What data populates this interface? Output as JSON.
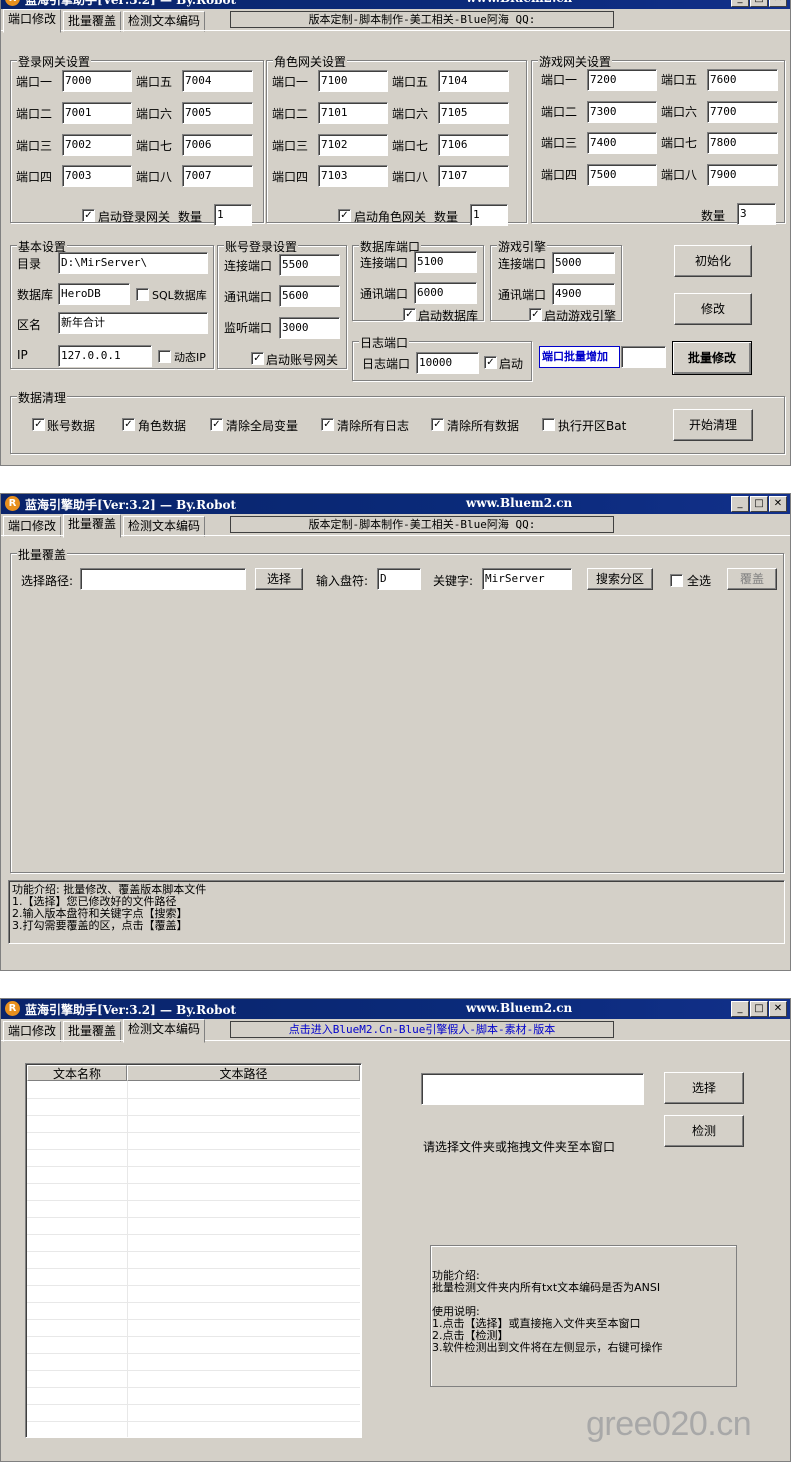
{
  "app": {
    "icon_glyph": "R",
    "title": "蓝海引擎助手[Ver:3.2] — By.Robot",
    "site": "www.Bluem2.cn",
    "tabs": [
      "端口修改",
      "批量覆盖",
      "检测文本编码"
    ]
  },
  "window1": {
    "banner": "版本定制-脚本制作-美工相关-Blue阿海 QQ:",
    "login_gateway": {
      "title": "登录网关设置",
      "ports": [
        {
          "label": "端口一",
          "value": "7000"
        },
        {
          "label": "端口五",
          "value": "7004"
        },
        {
          "label": "端口二",
          "value": "7001"
        },
        {
          "label": "端口六",
          "value": "7005"
        },
        {
          "label": "端口三",
          "value": "7002"
        },
        {
          "label": "端口七",
          "value": "7006"
        },
        {
          "label": "端口四",
          "value": "7003"
        },
        {
          "label": "端口八",
          "value": "7007"
        }
      ],
      "start_label": "启动登录网关",
      "count_label": "数量",
      "count_value": "1"
    },
    "role_gateway": {
      "title": "角色网关设置",
      "ports": [
        {
          "label": "端口一",
          "value": "7100"
        },
        {
          "label": "端口五",
          "value": "7104"
        },
        {
          "label": "端口二",
          "value": "7101"
        },
        {
          "label": "端口六",
          "value": "7105"
        },
        {
          "label": "端口三",
          "value": "7102"
        },
        {
          "label": "端口七",
          "value": "7106"
        },
        {
          "label": "端口四",
          "value": "7103"
        },
        {
          "label": "端口八",
          "value": "7107"
        }
      ],
      "start_label": "启动角色网关",
      "count_label": "数量",
      "count_value": "1"
    },
    "game_gateway": {
      "title": "游戏网关设置",
      "ports": [
        {
          "label": "端口一",
          "value": "7200"
        },
        {
          "label": "端口五",
          "value": "7600"
        },
        {
          "label": "端口二",
          "value": "7300"
        },
        {
          "label": "端口六",
          "value": "7700"
        },
        {
          "label": "端口三",
          "value": "7400"
        },
        {
          "label": "端口七",
          "value": "7800"
        },
        {
          "label": "端口四",
          "value": "7500"
        },
        {
          "label": "端口八",
          "value": "7900"
        }
      ],
      "count_label": "数量",
      "count_value": "3"
    },
    "basic": {
      "title": "基本设置",
      "dir_label": "目录",
      "dir_value": "D:\\MirServer\\",
      "db_label": "数据库",
      "db_value": "HeroDB",
      "sql_label": "SQL数据库",
      "zone_label": "区名",
      "zone_value": "新年合计",
      "ip_label": "IP",
      "ip_value": "127.0.0.1",
      "dynamic_ip_label": "动态IP"
    },
    "account_login": {
      "title": "账号登录设置",
      "connect_label": "连接端口",
      "connect_value": "5500",
      "comm_label": "通讯端口",
      "comm_value": "5600",
      "listen_label": "监听端口",
      "listen_value": "3000",
      "start_label": "启动账号网关"
    },
    "database_port": {
      "title": "数据库端口",
      "connect_label": "连接端口",
      "connect_value": "5100",
      "comm_label": "通讯端口",
      "comm_value": "6000",
      "start_label": "启动数据库"
    },
    "game_engine": {
      "title": "游戏引擎",
      "connect_label": "连接端口",
      "connect_value": "5000",
      "comm_label": "通讯端口",
      "comm_value": "4900",
      "start_label": "启动游戏引擎"
    },
    "log_port": {
      "title": "日志端口",
      "port_label": "日志端口",
      "port_value": "10000",
      "start_label": "启动"
    },
    "buttons": {
      "init": "初始化",
      "modify": "修改",
      "batch_add": "端口批量增加",
      "batch_modify": "批量修改"
    },
    "cleanup": {
      "title": "数据清理",
      "items": [
        "账号数据",
        "角色数据",
        "清除全局变量",
        "清除所有日志",
        "清除所有数据",
        "执行开区Bat"
      ],
      "start": "开始清理"
    }
  },
  "window2": {
    "banner": "版本定制-脚本制作-美工相关-Blue阿海 QQ:",
    "group_title": "批量覆盖",
    "path_label": "选择路径:",
    "path_value": "",
    "select_btn": "选择",
    "drive_label": "输入盘符:",
    "drive_value": "D",
    "keyword_label": "关键字:",
    "keyword_value": "MirServer",
    "search_btn": "搜索分区",
    "select_all_label": "全选",
    "overwrite_btn": "覆盖",
    "info": "功能介绍: 批量修改、覆盖版本脚本文件\n1.【选择】您已修改好的文件路径\n2.输入版本盘符和关键字点【搜索】\n3.打勾需要覆盖的区，点击【覆盖】"
  },
  "window3": {
    "banner": "点击进入BlueM2.Cn-Blue引擎假人-脚本-素材-版本",
    "col_name": "文本名称",
    "col_path": "文本路径",
    "path_value": "",
    "select_btn": "选择",
    "detect_btn": "检测",
    "hint": "请选择文件夹或拖拽文件夹至本窗口",
    "info": "功能介绍:\n批量检测文件夹内所有txt文本编码是否为ANSI\n\n使用说明:\n1.点击【选择】或直接拖入文件夹至本窗口\n2.点击【检测】\n3.软件检测出到文件将在左侧显示，右键可操作"
  },
  "watermark": "gree020.cn",
  "colors": {
    "titlebar": "#0a246a",
    "face": "#d4d0c8",
    "link_blue": "#0000cc"
  }
}
